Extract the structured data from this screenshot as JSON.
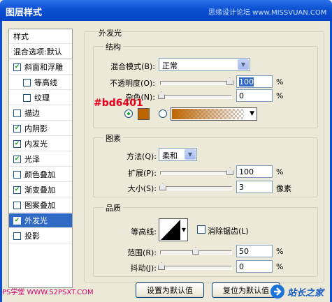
{
  "window": {
    "title": "图层样式",
    "watermark": "思缘设计论坛 www.MISSVUAN.COM"
  },
  "sidebar": {
    "header": "样式",
    "blend_label": "混合选项:默认",
    "items": [
      {
        "label": "斜面和浮雕",
        "checked": true
      },
      {
        "label": "等高线",
        "checked": false
      },
      {
        "label": "纹理",
        "checked": false
      },
      {
        "label": "描边",
        "checked": false
      },
      {
        "label": "内阴影",
        "checked": true
      },
      {
        "label": "内发光",
        "checked": true
      },
      {
        "label": "光泽",
        "checked": true
      },
      {
        "label": "颜色叠加",
        "checked": false
      },
      {
        "label": "渐变叠加",
        "checked": true
      },
      {
        "label": "图案叠加",
        "checked": false
      },
      {
        "label": "外发光",
        "checked": true
      },
      {
        "label": "投影",
        "checked": false
      }
    ]
  },
  "panel": {
    "title": "外发光",
    "structure": {
      "title": "结构",
      "blend_mode_label": "混合模式(B):",
      "blend_mode_value": "正常",
      "opacity_label": "不透明度(O):",
      "opacity_value": "100",
      "noise_label": "杂色(N):",
      "noise_value": "0",
      "percent": "%",
      "color_annotation": "#bd6401",
      "glow_color": "#bd6401"
    },
    "elements": {
      "title": "图素",
      "method_label": "方法(Q):",
      "method_value": "柔和",
      "spread_label": "扩展(P):",
      "spread_value": "100",
      "size_label": "大小(S):",
      "size_value": "3",
      "size_unit": "像素",
      "percent": "%"
    },
    "quality": {
      "title": "品质",
      "contour_label": "等高线:",
      "antialias_label": "消除锯齿(L)",
      "range_label": "范围(R):",
      "range_value": "50",
      "jitter_label": "抖动(J):",
      "jitter_value": "0",
      "percent": "%"
    },
    "buttons": {
      "set_default": "设置为默认值",
      "reset_default": "复位为默认值"
    }
  },
  "watermarks": {
    "bottom_left": "PS学堂 WWW.52PSXT.COM",
    "logo": "站长之家"
  }
}
